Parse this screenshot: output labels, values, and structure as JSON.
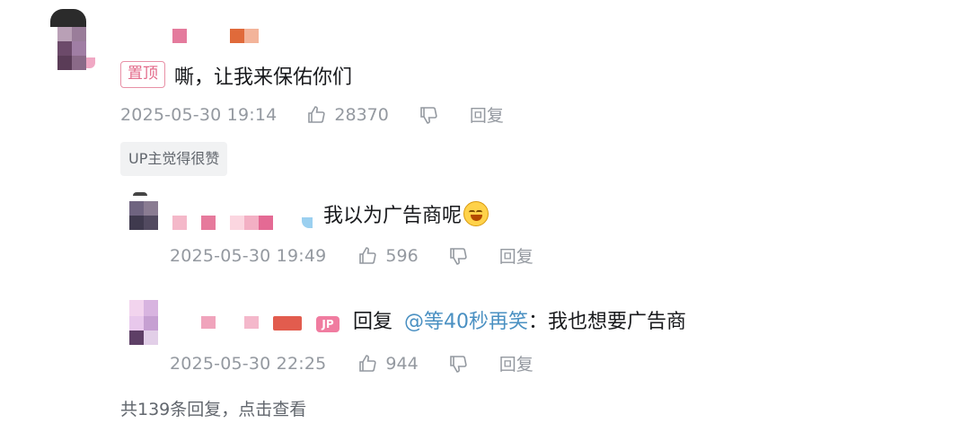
{
  "colors": {
    "pin_tag": "#e36a8a",
    "meta_gray": "#9499a0",
    "mention_blue": "#4a90c2",
    "up_liked_bg": "#f1f2f3"
  },
  "main_comment": {
    "pin_label": "置顶",
    "content": "嘶，让我来保佑你们",
    "time": "2025-05-30 19:14",
    "likes": "28370",
    "reply_label": "回复",
    "up_liked_badge": "UP主觉得很赞",
    "icons": [
      "thumb-up-icon",
      "thumb-down-icon"
    ]
  },
  "replies": [
    {
      "content": "我以为广告商呢",
      "emoji": "laugh-cry-emoji",
      "time": "2025-05-30 19:49",
      "likes": "596",
      "reply_label": "回复"
    },
    {
      "badge": "JP",
      "reply_prefix": "回复",
      "mention": "@等40秒再笑",
      "content": "：我也想要广告商",
      "time": "2025-05-30 22:25",
      "likes": "944",
      "reply_label": "回复"
    }
  ],
  "more_replies": "共139条回复，点击查看"
}
